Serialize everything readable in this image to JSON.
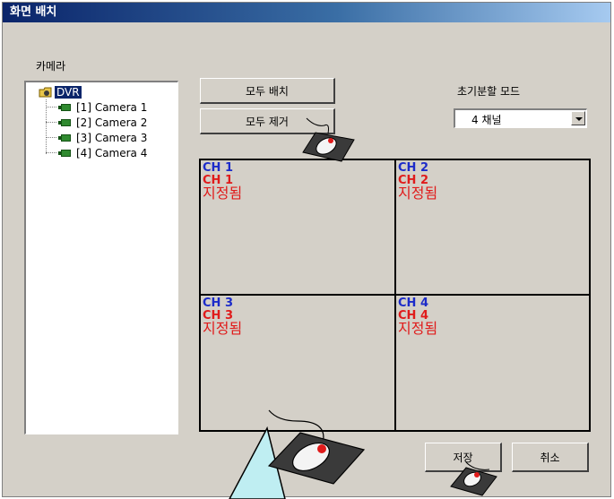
{
  "window": {
    "title": "화면 배치"
  },
  "camera_group": {
    "label": "카메라"
  },
  "tree": {
    "root": "DVR",
    "items": [
      {
        "label": "[1] Camera 1"
      },
      {
        "label": "[2] Camera 2"
      },
      {
        "label": "[3] Camera 3"
      },
      {
        "label": "[4] Camera 4"
      }
    ]
  },
  "buttons": {
    "place_all": "모두 배치",
    "remove_all": "모두 제거",
    "save": "저장",
    "cancel": "취소"
  },
  "split_mode": {
    "label": "초기분할 모드",
    "value": "4 채널"
  },
  "grid": {
    "cells": [
      {
        "channel": "CH 1",
        "assigned": "CH 1",
        "status": "지정됨"
      },
      {
        "channel": "CH 2",
        "assigned": "CH 2",
        "status": "지정됨"
      },
      {
        "channel": "CH 3",
        "assigned": "CH 3",
        "status": "지정됨"
      },
      {
        "channel": "CH 4",
        "assigned": "CH 4",
        "status": "지정됨"
      }
    ]
  },
  "colors": {
    "title_bar": "#0a246a",
    "dialog_bg": "#d4d0c8",
    "channel_blue": "#1c2bc9",
    "assigned_red": "#e01b1b",
    "pointer_cyan": "#bfeef2"
  },
  "icons": {
    "tree_root": "dvr-folder-icon",
    "camera": "camera-icon",
    "mouse": "mouse-click-icon"
  }
}
